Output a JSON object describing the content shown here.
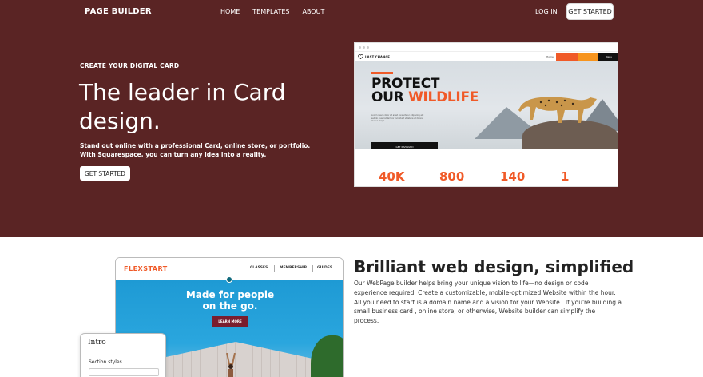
{
  "nav": {
    "brand": "PAGE BUILDER",
    "links": [
      "HOME",
      "TEMPLATES",
      "ABOUT"
    ],
    "login": "LOG IN",
    "cta": "GET STARTED"
  },
  "hero": {
    "eyebrow": "CREATE YOUR DIGITAL CARD",
    "headline": "The leader in Card design.",
    "subtext": "Stand out online with a professional Card, online store, or portfolio. With Squarespace, you can turn any idea into a reality.",
    "cta": "GET STARTED",
    "background": "#5a2424"
  },
  "preview": {
    "logo": "LAST CHANCE",
    "nav_item": "Home",
    "menu": "Menu",
    "title_line1": "PROTECT",
    "title_line2a": "OUR ",
    "title_line2b": "WILDLIFE",
    "paragraph": "Lorem ipsum dolor sit amet consectetur adipiscing elit sed do eiusmod tempor incididunt ut labore et dolore magna aliqua.",
    "cta": "GET INVOLVED",
    "stats": [
      "40K",
      "800",
      "140",
      "1"
    ],
    "accent": "#f05a28"
  },
  "section2": {
    "title": "Brilliant web design, simplified",
    "text": "Our WebPage builder helps bring your unique vision to life—no design or code experience required. Create a customizable, mobile-optimized Website within the hour. All you need to start is a domain name and a vision for your Website . If you're building a small business card , online store, or otherwise, Website builder can simplify the process."
  },
  "mock": {
    "logo": "FLEXSTART",
    "links": [
      "CLASSES",
      "MEMBERSHIP",
      "GUIDES"
    ],
    "headline_line1": "Made for people",
    "headline_line2": "on the go.",
    "button": "LEARN MORE"
  },
  "panel": {
    "title": "Intro",
    "label": "Section styles"
  }
}
